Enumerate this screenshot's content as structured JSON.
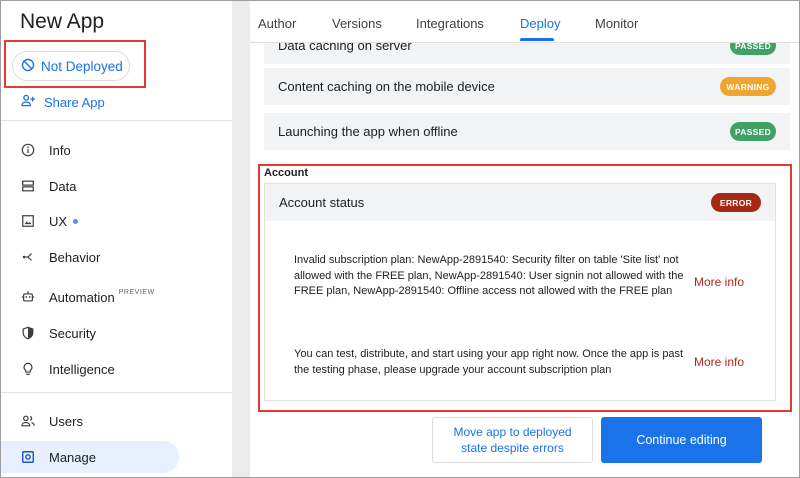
{
  "app": {
    "title": "New App"
  },
  "sidebar": {
    "deploy_status": "Not Deployed",
    "share_label": "Share App",
    "items": [
      {
        "label": "Info",
        "icon": "info-icon"
      },
      {
        "label": "Data",
        "icon": "data-icon"
      },
      {
        "label": "UX",
        "icon": "ux-icon"
      },
      {
        "label": "Behavior",
        "icon": "behavior-icon"
      },
      {
        "label": "Automation",
        "icon": "automation-icon",
        "tag": "PREVIEW"
      },
      {
        "label": "Security",
        "icon": "shield-icon"
      },
      {
        "label": "Intelligence",
        "icon": "lightbulb-icon"
      },
      {
        "label": "Users",
        "icon": "users-icon"
      },
      {
        "label": "Manage",
        "icon": "manage-icon",
        "active": true
      }
    ]
  },
  "tabs": [
    {
      "label": "Author"
    },
    {
      "label": "Versions"
    },
    {
      "label": "Integrations"
    },
    {
      "label": "Deploy",
      "active": true
    },
    {
      "label": "Monitor"
    }
  ],
  "checks": [
    {
      "label": "Data caching on server",
      "status": "PASSED"
    },
    {
      "label": "Content caching on the mobile device",
      "status": "WARNING"
    },
    {
      "label": "Launching the app when offline",
      "status": "PASSED"
    }
  ],
  "account": {
    "section_label": "Account",
    "status_label": "Account status",
    "status": "ERROR",
    "messages": [
      {
        "text": "Invalid subscription plan: NewApp-2891540: Security filter on table 'Site list' not allowed with the FREE plan, NewApp-2891540: User signin not allowed with the FREE plan, NewApp-2891540: Offline access not allowed with the FREE plan",
        "link": "More info"
      },
      {
        "text": "You can test, distribute, and start using your app right now. Once the app is past the testing phase, please upgrade your account subscription plan",
        "link": "More info"
      }
    ]
  },
  "actions": {
    "move_label": "Move app to deployed state despite errors",
    "continue_label": "Continue editing"
  },
  "colors": {
    "accent": "#1a73e8",
    "passed": "#3fa165",
    "warning": "#f1a531",
    "error": "#a52714",
    "highlight": "#e53935"
  }
}
